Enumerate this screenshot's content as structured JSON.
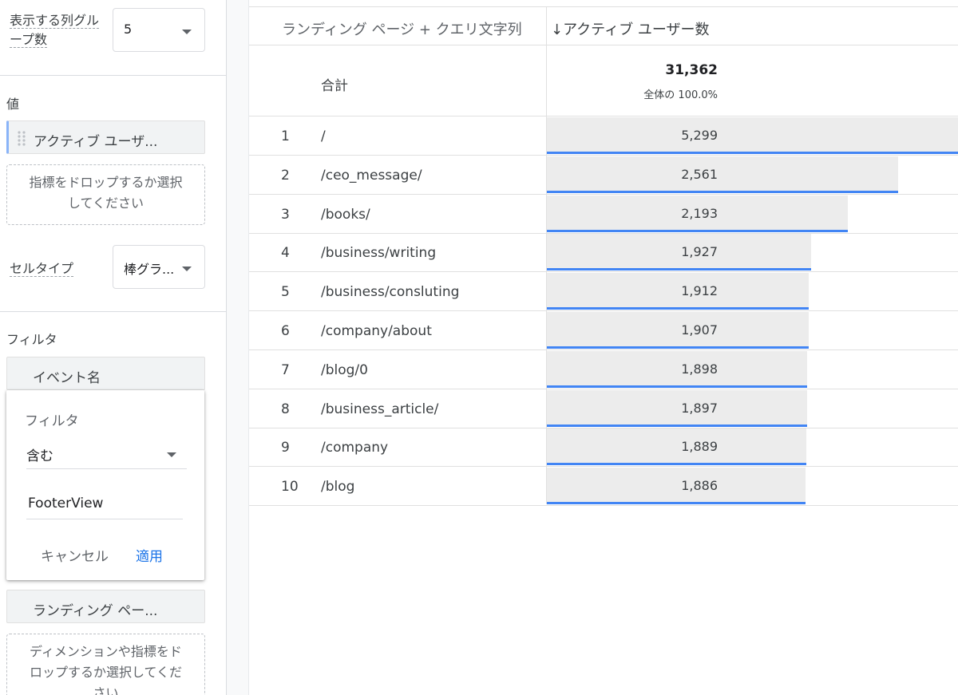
{
  "left_panel": {
    "column_group_label_1": "表示する列グル",
    "column_group_label_2": "ープ数",
    "column_group_value": "5",
    "values_label": "値",
    "value_chip": "アクティブ ユーザ...",
    "metric_drop_1": "指標をドロップするか選択",
    "metric_drop_2": "してください",
    "cell_type_label": "セルタイプ",
    "cell_type_value": "棒グラ...",
    "filter_label": "フィルタ",
    "filter_chip": "イベント名",
    "popup": {
      "title": "フィルタ",
      "match_type": "含む",
      "expression": "FooterView",
      "cancel": "キャンセル",
      "apply": "適用"
    },
    "landing_chip": "ランディング ペー...",
    "dim_drop_1": "ディメンションや指標をド",
    "dim_drop_2": "ロップするか選択してくだ",
    "dim_drop_3": "さい"
  },
  "table": {
    "dimension_header": "ランディング ページ + クエリ文字列",
    "metric_header": "↓アクティブ ユーザー数",
    "total_label": "合計",
    "total_value": "31,362",
    "total_pct": "全体の 100.0%",
    "rows": [
      {
        "rank": "1",
        "page": "/",
        "value": "5,299",
        "fraction": 1.0
      },
      {
        "rank": "2",
        "page": "/ceo_message/",
        "value": "2,561",
        "fraction": 0.853
      },
      {
        "rank": "3",
        "page": "/books/",
        "value": "2,193",
        "fraction": 0.73
      },
      {
        "rank": "4",
        "page": "/business/writing",
        "value": "1,927",
        "fraction": 0.641
      },
      {
        "rank": "5",
        "page": "/business/consluting",
        "value": "1,912",
        "fraction": 0.636
      },
      {
        "rank": "6",
        "page": "/company/about",
        "value": "1,907",
        "fraction": 0.635
      },
      {
        "rank": "7",
        "page": "/blog/0",
        "value": "1,898",
        "fraction": 0.632
      },
      {
        "rank": "8",
        "page": "/business_article/",
        "value": "1,897",
        "fraction": 0.631
      },
      {
        "rank": "9",
        "page": "/company",
        "value": "1,889",
        "fraction": 0.629
      },
      {
        "rank": "10",
        "page": "/blog",
        "value": "1,886",
        "fraction": 0.628
      }
    ]
  },
  "colors": {
    "accent": "#4285f4",
    "bar_fill": "#ececec",
    "apply_link": "#1a73e8"
  }
}
